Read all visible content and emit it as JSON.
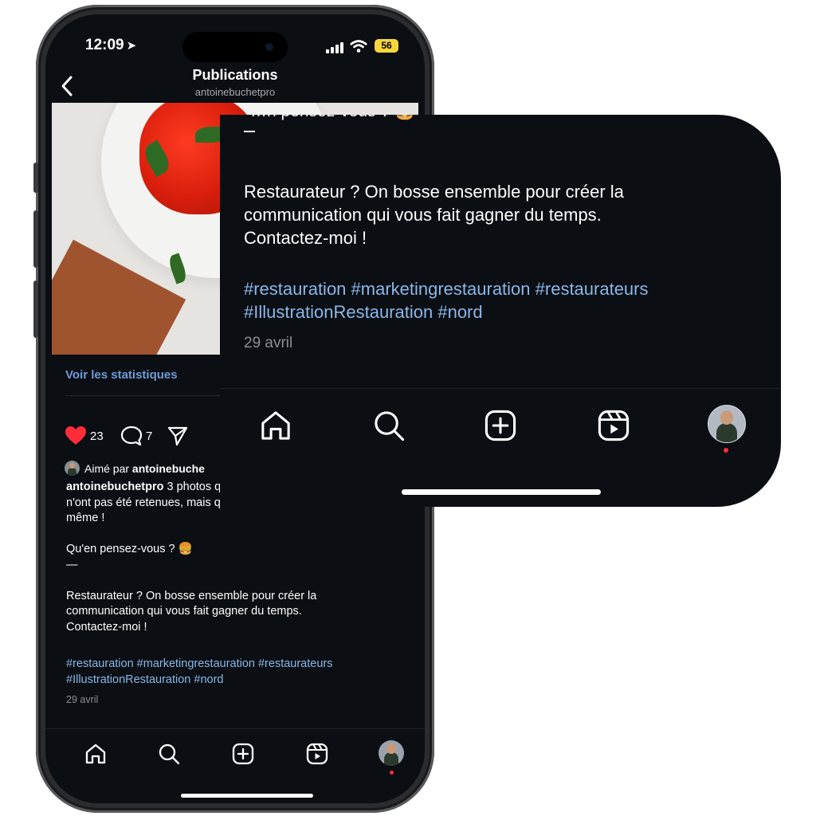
{
  "status": {
    "time": "12:09",
    "battery": "56"
  },
  "header": {
    "title": "Publications",
    "username": "antoinebuchetpro"
  },
  "post": {
    "stats_link": "Voir les statistiques",
    "likes": "23",
    "comments": "7",
    "liked_by_prefix": "Aimé par",
    "liked_by_user": "antoinebuche",
    "caption_user": "antoinebuchetpro",
    "caption_line1": "3 photos q",
    "caption_line2": "n'ont pas été retenues, mais que",
    "caption_line3": "même !",
    "question": "Qu'en pensez-vous ? 🍔",
    "dash": "—",
    "body_line1": "Restaurateur ? On bosse ensemble pour créer la",
    "body_line2": "communication qui vous fait gagner du temps.",
    "body_line3": "Contactez-moi !",
    "hashtags_line1": "#restauration #marketingrestauration #restaurateurs",
    "hashtags_line2": "#IllustrationRestauration #nord",
    "date": "29 avril"
  },
  "zoom": {
    "cut_text": "…n pensez-vous ? 🍔"
  },
  "tabs": [
    "home-icon",
    "search-icon",
    "create-icon",
    "reels-icon",
    "profile-avatar"
  ],
  "colors": {
    "background": "#0b0e13",
    "hashtag": "#8ab8ea",
    "link": "#6f9bd8",
    "like": "#ff2d3a"
  }
}
